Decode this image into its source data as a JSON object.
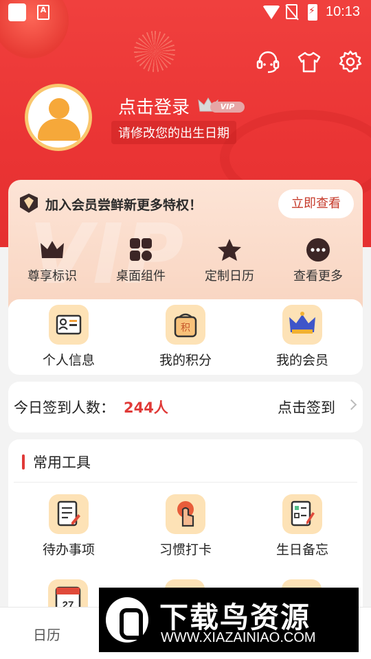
{
  "status_bar": {
    "time": "10:13"
  },
  "profile": {
    "login_text": "点击登录",
    "vip_tag": "VIP",
    "birthday_prompt": "请修改您的出生日期"
  },
  "vip_card": {
    "title": "加入会员尝鲜新更多特权！",
    "view_button": "立即查看",
    "perks": [
      {
        "label": "尊享标识",
        "icon": "crown-icon"
      },
      {
        "label": "桌面组件",
        "icon": "widgets-icon"
      },
      {
        "label": "定制日历",
        "icon": "star-icon"
      },
      {
        "label": "查看更多",
        "icon": "more-icon"
      }
    ]
  },
  "shortcuts": [
    {
      "label": "个人信息",
      "icon": "id-card-icon"
    },
    {
      "label": "我的积分",
      "icon": "points-bag-icon"
    },
    {
      "label": "我的会员",
      "icon": "crown-icon"
    }
  ],
  "checkin": {
    "label": "今日签到人数：",
    "count": "244人",
    "action": "点击签到"
  },
  "tools": {
    "title": "常用工具",
    "items": [
      {
        "label": "待办事项",
        "icon": "todo-icon"
      },
      {
        "label": "习惯打卡",
        "icon": "habit-icon"
      },
      {
        "label": "生日备忘",
        "icon": "birthday-memo-icon"
      }
    ]
  },
  "calendar_icon_day": "27",
  "bottom_nav": {
    "calendar_tab": "日历"
  },
  "watermark": {
    "title": "下载鸟资源",
    "url": "WWW.XIAZAINIAO.COM"
  },
  "colors": {
    "primary_red": "#ea3434",
    "accent_gold": "#f6a83a",
    "icon_bg": "#fde2b6"
  }
}
